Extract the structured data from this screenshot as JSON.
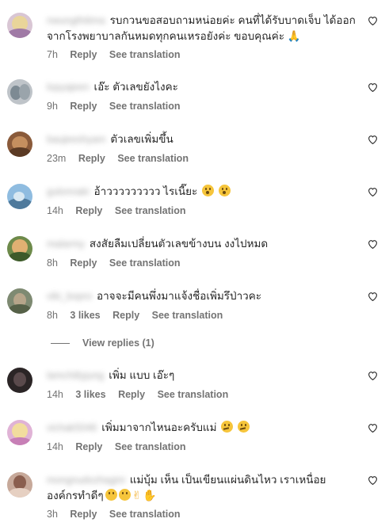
{
  "comments": [
    {
      "username": "nwungthitima",
      "text": "รบกวนขอสอบถามหน่อยค่ะ คนที่ได้รับบาดเจ็บ ได้ออกจากโรงพยาบาลกันหมดทุกคนเหรอยังค่ะ ขอบคุณค่ะ 🙏",
      "time": "7h",
      "likes": "",
      "reply": "Reply",
      "translate": "See translation"
    },
    {
      "username": "lopyajeen",
      "text": "เอ๊ะ ตัวเลขยังไงคะ",
      "time": "9h",
      "likes": "",
      "reply": "Reply",
      "translate": "See translation"
    },
    {
      "username": "baujeeshyam",
      "text": "ตัวเลขเพิ่มขึ้น",
      "time": "23m",
      "likes": "",
      "reply": "Reply",
      "translate": "See translation"
    },
    {
      "username": "gulonnaki",
      "text": "อ้าววววววววว ไรเนี๊ยะ",
      "time": "14h",
      "likes": "",
      "reply": "Reply",
      "translate": "See translation"
    },
    {
      "username": "malarmy",
      "text": "สงสัยลืมเปลี่ยนตัวเลขข้างบน งงไปหมด",
      "time": "8h",
      "likes": "",
      "reply": "Reply",
      "translate": "See translation"
    },
    {
      "username": "viki_bopro",
      "text": "อาจจะมีคนพึ่งมาแจ้งชื่อเพิ่มรึป่าวคะ",
      "time": "8h",
      "likes": "3 likes",
      "reply": "Reply",
      "translate": "See translation"
    },
    {
      "username": "lamchitlyjung",
      "text": "เพิ่ม แบบ เอ๊ะๆ",
      "time": "14h",
      "likes": "3 likes",
      "reply": "Reply",
      "translate": "See translation"
    },
    {
      "username": "vichak5046",
      "text": "เพิ่มมาจากไหนอะครับแม่",
      "time": "14h",
      "likes": "",
      "reply": "Reply",
      "translate": "See translation"
    },
    {
      "username": "mongnudozhagini",
      "text": "แม่บุ้ม เห็น เป็นเขียนแผ่นดินไหว เราเหนื่อย องค์กรทำดีๆ",
      "time": "3h",
      "likes": "",
      "reply": "Reply",
      "translate": "See translation"
    }
  ],
  "view_replies": "View replies (1)",
  "colors": {
    "text": "#262626",
    "meta": "#737373",
    "background": "#ffffff"
  },
  "icons": {
    "like": "heart-outline-icon"
  }
}
